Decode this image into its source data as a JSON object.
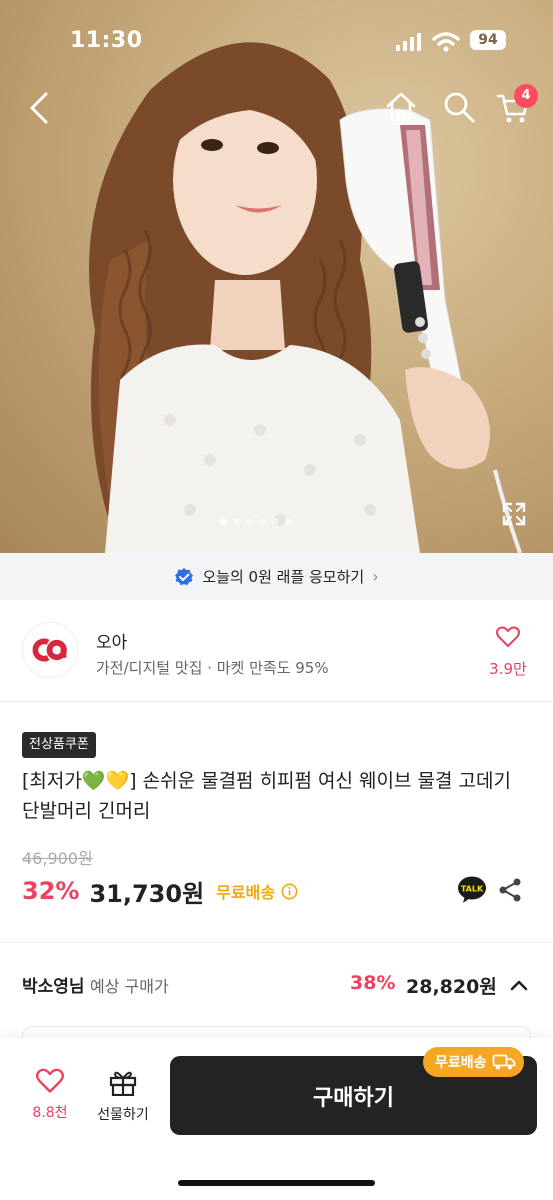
{
  "status_bar": {
    "time": "11:30",
    "battery": "94"
  },
  "nav": {
    "cart_count": "4"
  },
  "raffle_banner": {
    "text": "오늘의 0원 래플 응모하기"
  },
  "seller": {
    "name": "오아",
    "meta": "가전/디지털 맛집 · 마켓 만족도 95%",
    "like_count": "3.9만"
  },
  "product": {
    "coupon_tag": "전상품쿠폰",
    "title": "[최저가💚💛] 손쉬운 물결펌 히피펌 여신 웨이브 물결 고데기 단발머리 긴머리",
    "original_price": "46,900원",
    "discount": "32%",
    "price": "31,730원",
    "shipping": "무료배송"
  },
  "expected_price": {
    "user": "박소영님",
    "label": "예상 구매가",
    "discount": "38%",
    "price": "28,820원"
  },
  "bottom_bar": {
    "wish_count": "8.8천",
    "gift_label": "선물하기",
    "buy_label": "구매하기",
    "free_badge": "무료배송"
  },
  "colors": {
    "accent_red": "#ef4062",
    "free_shipping_orange": "#f3a712",
    "buy_button": "#232323"
  }
}
